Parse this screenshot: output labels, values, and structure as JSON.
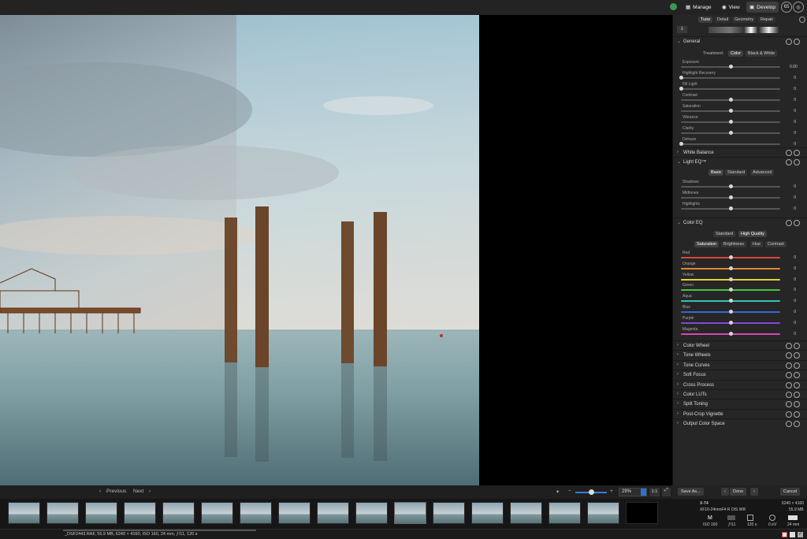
{
  "topbar": {
    "modes": [
      "Manage",
      "View",
      "Develop"
    ],
    "icon_label": "65"
  },
  "viewer": {
    "compare_split": true
  },
  "toolbar": {
    "previous_label": "Previous",
    "next_label": "Next",
    "zoom_value": "29%",
    "one_to_one": "1:1"
  },
  "panel": {
    "tabs": [
      "Tune",
      "Detail",
      "Geometry",
      "Repair"
    ],
    "general": {
      "title": "General",
      "treatment_label": "Treatment:",
      "treatment_options": [
        "Color",
        "Black & White"
      ],
      "sliders": [
        {
          "label": "Exposure",
          "value": "0.00",
          "pos": 0.5
        },
        {
          "label": "Highlight Recovery",
          "value": "0",
          "pos": 0.0
        },
        {
          "label": "Fill Light",
          "value": "0",
          "pos": 0.0
        },
        {
          "label": "Contrast",
          "value": "0",
          "pos": 0.5
        },
        {
          "label": "Saturation",
          "value": "0",
          "pos": 0.5
        },
        {
          "label": "Vibrance",
          "value": "0",
          "pos": 0.5
        },
        {
          "label": "Clarity",
          "value": "0",
          "pos": 0.5
        },
        {
          "label": "Dehaze",
          "value": "0",
          "pos": 0.0
        }
      ]
    },
    "white_balance": {
      "title": "White Balance"
    },
    "light_eq": {
      "title": "Light EQ™",
      "modes": [
        "Basic",
        "Standard",
        "Advanced"
      ],
      "sliders": [
        {
          "label": "Shadows",
          "value": "0",
          "pos": 0.5
        },
        {
          "label": "Midtones",
          "value": "0",
          "pos": 0.5
        },
        {
          "label": "Highlights",
          "value": "0",
          "pos": 0.5
        }
      ]
    },
    "color_eq": {
      "title": "Color EQ",
      "quality": [
        "Standard",
        "High Quality"
      ],
      "modes": [
        "Saturation",
        "Brightness",
        "Hue",
        "Contrast"
      ],
      "sliders": [
        {
          "label": "Red",
          "value": "0",
          "color": "#d9463c"
        },
        {
          "label": "Orange",
          "value": "0",
          "color": "#e8832c"
        },
        {
          "label": "Yellow",
          "value": "0",
          "color": "#e3d232"
        },
        {
          "label": "Green",
          "value": "0",
          "color": "#48c341"
        },
        {
          "label": "Aqua",
          "value": "0",
          "color": "#2fc6b8"
        },
        {
          "label": "Blue",
          "value": "0",
          "color": "#3466d9"
        },
        {
          "label": "Purple",
          "value": "0",
          "color": "#8746d4"
        },
        {
          "label": "Magenta",
          "value": "0",
          "color": "#d547b8"
        }
      ]
    },
    "collapsed_sections": [
      "Color Wheel",
      "Tone Wheels",
      "Tone Curves",
      "Soft Focus",
      "Cross Process",
      "Color LUTs",
      "Split Toning",
      "Post-Crop Vignette",
      "Output Color Space"
    ],
    "footer": {
      "save_as": "Save As...",
      "done": "Done",
      "cancel": "Cancel"
    }
  },
  "camera_info": {
    "model": "X-T4",
    "lens": "XF10-24mmF4 R OIS WR",
    "dimensions": "6240 × 4160",
    "size": "55.9 MB",
    "iso": "ISO 160",
    "aperture": "ƒ/11",
    "shutter": "120 s",
    "ev": "0 eV",
    "focal": "24 mm",
    "mode": "M"
  },
  "statusbar": {
    "text": "_DSF2443.RAF, 55.9 MB, 6240 × 4160, ISO 160, 24 mm, ƒ/11, 120 s"
  }
}
